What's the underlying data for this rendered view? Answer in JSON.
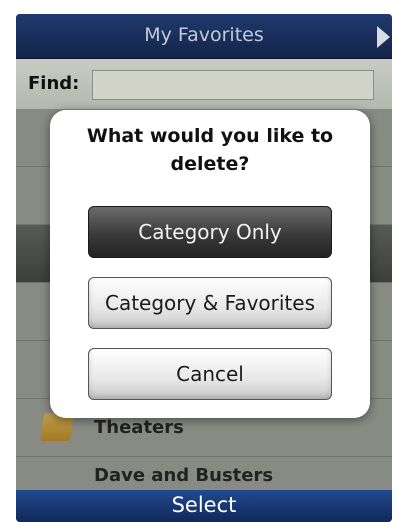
{
  "header": {
    "title": "My Favorites",
    "next_icon": "right-arrow-icon"
  },
  "find": {
    "label": "Find:",
    "value": "",
    "placeholder": ""
  },
  "list": {
    "items": [
      {
        "label": "Theaters",
        "icon": "folder-icon"
      },
      {
        "label": "Dave and Busters",
        "icon": "folder-icon"
      }
    ]
  },
  "dialog": {
    "question": "What would you like to delete?",
    "buttons": {
      "category_only": "Category Only",
      "category_and_favorites": "Category & Favorites",
      "cancel": "Cancel"
    }
  },
  "footer": {
    "select_label": "Select"
  },
  "colors": {
    "titlebar": "#1f3a6e",
    "footer": "#214a8e",
    "selected_button": "#3a3a3a"
  }
}
